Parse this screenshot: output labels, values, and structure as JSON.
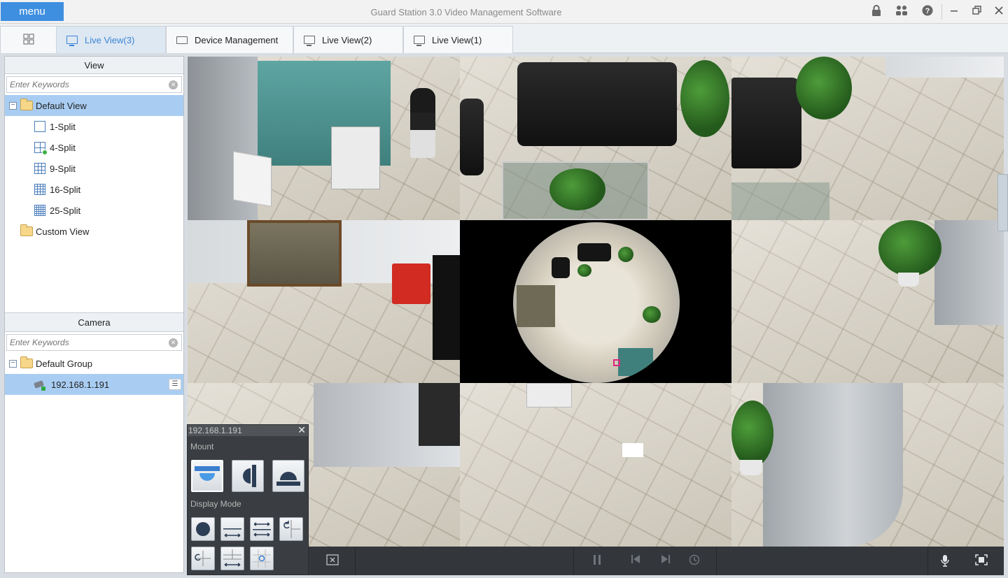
{
  "titlebar": {
    "menu_label": "menu",
    "app_title": "Guard Station 3.0 Video Management Software",
    "icons": [
      "lock-icon",
      "users-icon",
      "help-icon",
      "minimize-icon",
      "restore-icon",
      "close-icon"
    ]
  },
  "tabs": [
    {
      "label": "Live View(3)",
      "active": true
    },
    {
      "label": "Device Management",
      "active": false
    },
    {
      "label": "Live View(2)",
      "active": false
    },
    {
      "label": "Live View(1)",
      "active": false
    }
  ],
  "view_panel": {
    "title": "View",
    "search_placeholder": "Enter Keywords",
    "tree": {
      "default_view": "Default View",
      "splits": [
        "1-Split",
        "4-Split",
        "9-Split",
        "16-Split",
        "25-Split"
      ],
      "custom_view": "Custom View"
    }
  },
  "camera_panel": {
    "title": "Camera",
    "search_placeholder": "Enter Keywords",
    "group": "Default Group",
    "device": "192.168.1.191"
  },
  "fisheye_panel": {
    "device": "192.168.1.191",
    "mount_label": "Mount",
    "display_mode_label": "Display Mode"
  },
  "colors": {
    "accent": "#3f8fe0",
    "tab_active_text": "#3b84d6",
    "selection": "#a9cdf2",
    "selected_tile_border": "#d6307d"
  }
}
